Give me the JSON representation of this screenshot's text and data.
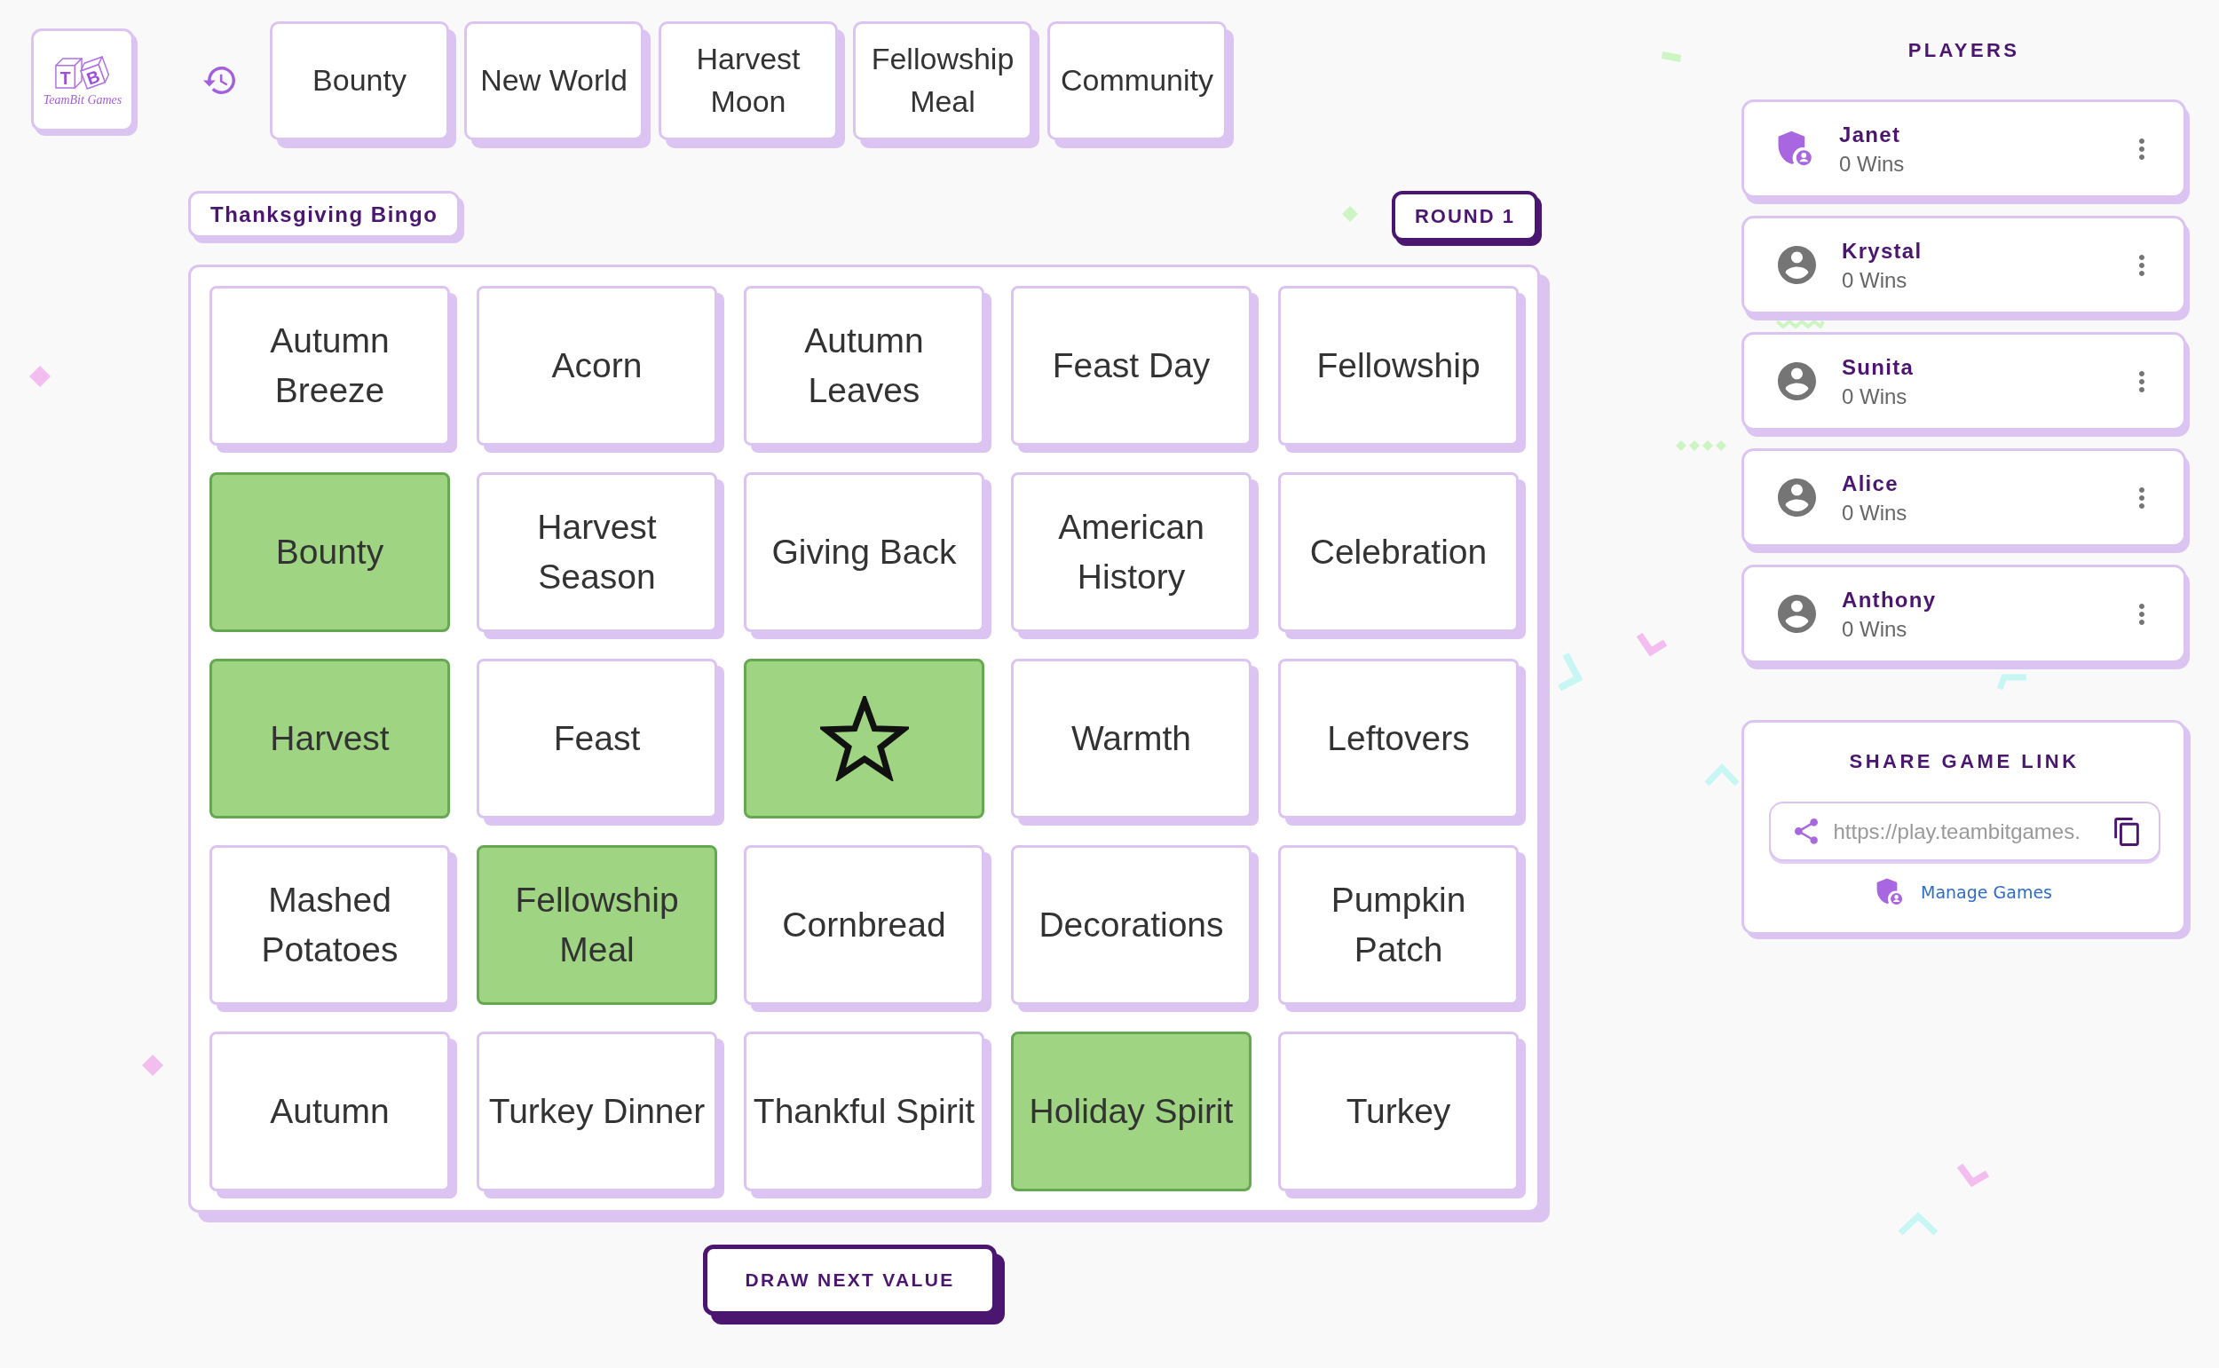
{
  "logo": {
    "letters": [
      "T",
      "B"
    ],
    "caption": "TeamBit Games"
  },
  "drawn_values": [
    "Bounty",
    "New World",
    "Harvest Moon",
    "Fellowship Meal",
    "Community"
  ],
  "game": {
    "title": "Thanksgiving Bingo",
    "round": "ROUND 1"
  },
  "board": {
    "cells": [
      {
        "kind": "word",
        "label": "Autumn Breeze",
        "marked": false
      },
      {
        "kind": "word",
        "label": "Acorn",
        "marked": false
      },
      {
        "kind": "word",
        "label": "Autumn Leaves",
        "marked": false
      },
      {
        "kind": "word",
        "label": "Feast Day",
        "marked": false
      },
      {
        "kind": "word",
        "label": "Fellowship",
        "marked": false
      },
      {
        "kind": "word",
        "label": "Bounty",
        "marked": true
      },
      {
        "kind": "word",
        "label": "Harvest Season",
        "marked": false
      },
      {
        "kind": "word",
        "label": "Giving Back",
        "marked": false
      },
      {
        "kind": "word",
        "label": "American History",
        "marked": false
      },
      {
        "kind": "word",
        "label": "Celebration",
        "marked": false
      },
      {
        "kind": "word",
        "label": "Harvest",
        "marked": true
      },
      {
        "kind": "word",
        "label": "Feast",
        "marked": false
      },
      {
        "kind": "free",
        "marked": true
      },
      {
        "kind": "word",
        "label": "Warmth",
        "marked": false
      },
      {
        "kind": "word",
        "label": "Leftovers",
        "marked": false
      },
      {
        "kind": "word",
        "label": "Mashed Potatoes",
        "marked": false
      },
      {
        "kind": "word",
        "label": "Fellowship Meal",
        "marked": true
      },
      {
        "kind": "word",
        "label": "Cornbread",
        "marked": false
      },
      {
        "kind": "word",
        "label": "Decorations",
        "marked": false
      },
      {
        "kind": "word",
        "label": "Pumpkin Patch",
        "marked": false
      },
      {
        "kind": "word",
        "label": "Autumn",
        "marked": false
      },
      {
        "kind": "word",
        "label": "Turkey Dinner",
        "marked": false
      },
      {
        "kind": "word",
        "label": "Thankful Spirit",
        "marked": false
      },
      {
        "kind": "word",
        "label": "Holiday Spirit",
        "marked": true
      },
      {
        "kind": "word",
        "label": "Turkey",
        "marked": false
      }
    ]
  },
  "draw_button": "DRAW NEXT VALUE",
  "players": {
    "heading": "PLAYERS",
    "items": [
      {
        "name": "Janet",
        "wins": "0 Wins",
        "kind": "host"
      },
      {
        "name": "Krystal",
        "wins": "0 Wins",
        "kind": "player"
      },
      {
        "name": "Sunita",
        "wins": "0 Wins",
        "kind": "player"
      },
      {
        "name": "Alice",
        "wins": "0 Wins",
        "kind": "player"
      },
      {
        "name": "Anthony",
        "wins": "0 Wins",
        "kind": "player"
      }
    ]
  },
  "share": {
    "heading": "SHARE GAME LINK",
    "value": "https://play.teambitgames.",
    "manage_link": "Manage Games"
  }
}
